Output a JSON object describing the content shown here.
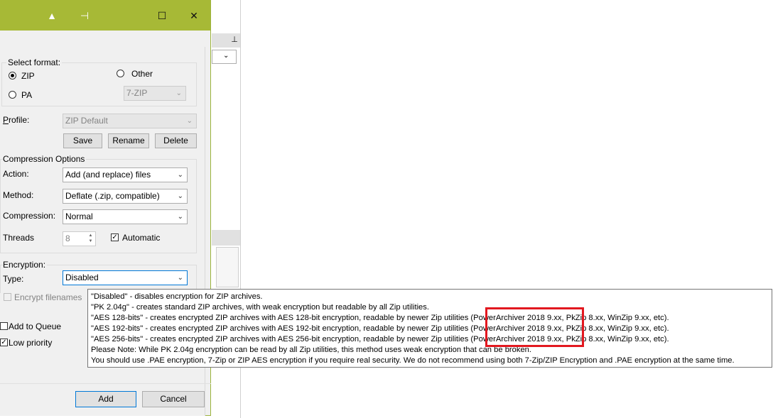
{
  "titlebar": {
    "icon_up": "▲",
    "icon_pin": "⊣",
    "icon_max": "☐",
    "icon_close": "✕"
  },
  "format": {
    "group_label": "Select format:",
    "zip_label": "ZIP",
    "pa_label": "PA",
    "other_label": "Other",
    "other_combo_value": "7-ZIP",
    "selected": "ZIP"
  },
  "profile": {
    "label": "Profile:",
    "value": "ZIP Default",
    "save_label": "Save",
    "rename_label": "Rename",
    "delete_label": "Delete"
  },
  "compression": {
    "group_label": "Compression Options",
    "action_label": "Action:",
    "action_value": "Add (and replace) files",
    "method_label": "Method:",
    "method_value": "Deflate (.zip, compatible)",
    "compression_label": "Compression:",
    "compression_value": "Normal",
    "threads_label": "Threads",
    "threads_value": "8",
    "automatic_label": "Automatic",
    "automatic_checked": true
  },
  "encryption": {
    "group_label": "Encryption:",
    "type_label": "Type:",
    "type_value": "Disabled",
    "encrypt_filenames_label": "Encrypt filenames"
  },
  "options": {
    "add_to_queue_label": "Add to Queue",
    "low_priority_label": "Low priority",
    "low_priority_checked": true
  },
  "footer": {
    "add_label": "Add",
    "cancel_label": "Cancel"
  },
  "tooltip": {
    "lines": [
      "\"Disabled\" - disables encryption for ZIP archives.",
      "\"PK 2.04g\" - creates standard ZIP archives, with weak encryption but readable by all Zip utilities.",
      "\"AES 128-bits\" - creates encrypted ZIP archives with AES 128-bit encryption, readable by newer Zip utilities (PowerArchiver 2018 9.xx, PkZip 8.xx, WinZip 9.xx, etc).",
      "\"AES 192-bits\" - creates encrypted ZIP archives with AES 192-bit encryption, readable by newer Zip utilities (PowerArchiver 2018 9.xx, PkZip 8.xx, WinZip 9.xx, etc).",
      "\"AES 256-bits\" - creates encrypted ZIP archives with AES 256-bit encryption, readable by newer Zip utilities (PowerArchiver 2018 9.xx, PkZip 8.xx, WinZip 9.xx, etc).",
      "Please Note: While PK 2.04g encryption can be read by all Zip utilities, this method uses weak encryption that can be broken.",
      "You should use .PAE encryption, 7-Zip or ZIP AES encryption if you require real security. We do not recommend using both 7-Zip/ZIP Encryption and .PAE encryption at the same time."
    ]
  },
  "colors": {
    "titlebar": "#a7b936",
    "highlight": "#e2181f",
    "focus": "#0078d7"
  }
}
